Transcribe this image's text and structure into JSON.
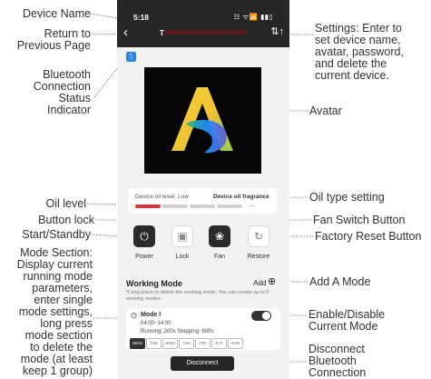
{
  "annotations": {
    "device_name": "Device Name",
    "return": [
      "Return to",
      "Previous Page"
    ],
    "bluetooth": [
      "Bluetooth",
      "Connection",
      "Status",
      "Indicator"
    ],
    "settings": [
      "Settings: Enter to",
      "set device name,",
      "avatar, password,",
      "and delete the",
      "current device."
    ],
    "avatar": "Avatar",
    "oil_level": "Oil level",
    "oil_type": "Oil type setting",
    "button_lock": "Button lock",
    "start_standby": "Start/Standby",
    "fan_switch": "Fan Switch Button",
    "factory_reset": "Factory Reset Button",
    "mode_section": [
      "Mode Section:",
      "Display current",
      "running mode",
      "parameters,",
      "enter single",
      "mode settings,",
      "long press",
      "mode section",
      "to delete the",
      "mode (at least",
      "keep 1 group)"
    ],
    "add_mode": "Add A Mode",
    "enable_disable": [
      "Enable/Disable",
      "Current Mode"
    ],
    "disconnect_bt": [
      "Disconnect",
      "Bluetooth",
      "Connection"
    ]
  },
  "phone": {
    "status_bar": {
      "time": "5:18",
      "signal": "☷ ᯤ📶 ▮▮▯"
    },
    "device_name_initial": "T",
    "oil": {
      "level_label": "Device oil level:",
      "level_value": "Low",
      "type_label": "Device oil fragrance",
      "type_value": "---",
      "segments_total": 4,
      "segments_filled": 1
    },
    "buttons": [
      "Power",
      "Lock",
      "Fan",
      "Restore"
    ],
    "working_mode": {
      "title": "Working Mode",
      "add_label": "Add",
      "hint": "*Long press to delete the working mode. You can create up to 5 working modes.",
      "mode": {
        "name": "Mode I",
        "time_range": "04:00~14:00",
        "running": "Running: 200s Stopping: 600s",
        "enabled": true,
        "days": [
          "MON",
          "TUE",
          "WED",
          "THU",
          "FRI",
          "SAT",
          "SUN"
        ],
        "selected_day": "MON"
      }
    },
    "disconnect_label": "Disconnect"
  },
  "colors": {
    "accent_red": "#d9303a",
    "bluetooth_blue": "#2f86e4",
    "dark": "#262626"
  }
}
